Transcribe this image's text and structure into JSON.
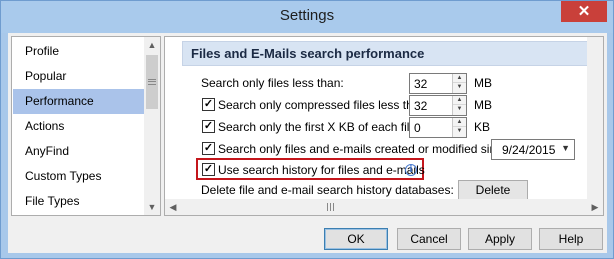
{
  "window": {
    "title": "Settings",
    "close_label": "✕"
  },
  "nav": {
    "items": [
      {
        "label": "Profile"
      },
      {
        "label": "Popular"
      },
      {
        "label": "Performance"
      },
      {
        "label": "Actions"
      },
      {
        "label": "AnyFind"
      },
      {
        "label": "Custom Types"
      },
      {
        "label": "File Types"
      }
    ],
    "selected": "Performance"
  },
  "section": {
    "title": "Files and E-Mails search performance"
  },
  "rows": {
    "size_limit": {
      "label": "Search only files less than:",
      "value": "32",
      "unit": "MB"
    },
    "compressed_limit": {
      "label": "Search only compressed files less than:",
      "checked": true,
      "value": "32",
      "unit": "MB"
    },
    "first_kb": {
      "label": "Search only the first X KB of each file:",
      "checked": true,
      "value": "0",
      "unit": "KB"
    },
    "date_filter": {
      "label": "Search only files and e-mails created or modified since:",
      "checked": true,
      "value": "9/24/2015"
    },
    "history": {
      "label": "Use search history for files and e-mails",
      "checked": true,
      "info": "i"
    },
    "delete_history": {
      "label": "Delete file and e-mail search history databases:",
      "button": "Delete"
    }
  },
  "buttons": {
    "ok": "OK",
    "cancel": "Cancel",
    "apply": "Apply",
    "help": "Help"
  }
}
